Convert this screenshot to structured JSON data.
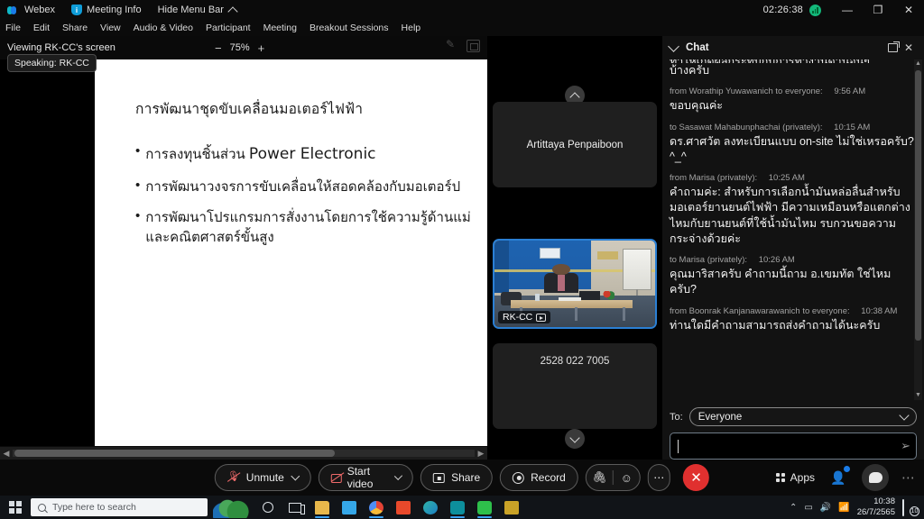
{
  "titlebar": {
    "app_name": "Webex",
    "meeting_info": "Meeting Info",
    "hide_menu_bar": "Hide Menu Bar",
    "timer": "02:26:38",
    "minimize": "—",
    "restore": "❐",
    "close": "✕"
  },
  "menubar": {
    "items": [
      "File",
      "Edit",
      "Share",
      "View",
      "Audio & Video",
      "Participant",
      "Meeting",
      "Breakout Sessions",
      "Help"
    ]
  },
  "sharebar": {
    "viewing_title": "Viewing RK-CC's screen",
    "zoom_out": "−",
    "zoom_level": "75%",
    "zoom_in": "+",
    "speaking_badge": "Speaking: RK-CC",
    "layout_button": "Layout"
  },
  "slide": {
    "title": "การพัฒนาชุดขับเคลื่อนมอเตอร์ไฟฟ้า",
    "bullets": [
      {
        "thai": "การลงทุนชิ้นส่วน ",
        "en": "Power Electronic"
      },
      {
        "thai": "การพัฒนาวงจรการขับเคลื่อนให้สอดคล้องกับมอเตอร์ป",
        "en": ""
      },
      {
        "thai": "การพัฒนาโปรแกรมการสั่งงานโดยการใช้ความรู้ด้านแม่ และคณิตศาสตร์ขั้นสูง",
        "en": ""
      }
    ]
  },
  "video_strip": {
    "scroll_up": "▲",
    "scroll_down": "▼",
    "tiles": [
      {
        "name": "Artittaya Penpaiboon",
        "type": "name-only"
      },
      {
        "name": "RK-CC",
        "type": "video",
        "active_speaker": true
      },
      {
        "name": "2528 022 7005",
        "type": "meeting-number"
      }
    ]
  },
  "chat": {
    "title": "Chat",
    "messages": [
      {
        "meta": "",
        "time": "",
        "text": "บ้างครับ",
        "truncated_top": true
      },
      {
        "meta": "from Worathip Yuwawanich to everyone:",
        "time": "9:56 AM",
        "text": "ขอบคุณค่ะ"
      },
      {
        "meta": "to Sasawat Mahabunphachai (privately):",
        "time": "10:15 AM",
        "text": "ดร.ศาศวัต ลงทะเบียนแบบ on-site ไม่ใช่เหรอครับ? ^_^"
      },
      {
        "meta": "from Marisa (privately):",
        "time": "10:25 AM",
        "text": "คำถามค่ะ: สำหรับการเลือกน้ำมันหล่อลื่นสำหรับมอเตอร์ยานยนต์ไฟฟ้า มีความเหมือนหรือแตกต่างไหมกับยานยนต์ที่ใช้น้ำมันไหม รบกวนขอความกระจ่างด้วยค่ะ"
      },
      {
        "meta": "to Marisa (privately):",
        "time": "10:26 AM",
        "text": "คุณมาริสาครับ คำถามนี้ถาม อ.เขมทัต ใช่ไหมครับ?"
      },
      {
        "meta": "from Boonrak Kanjanawarawanich to everyone:",
        "time": "10:38 AM",
        "text": "ท่านใดมีคำถามสามารถส่งคำถามได้นะครับ"
      }
    ],
    "to_label": "To:",
    "to_value": "Everyone",
    "message_placeholder": "",
    "message_value": ""
  },
  "controls": {
    "unmute": "Unmute",
    "start_video": "Start video",
    "share": "Share",
    "record": "Record",
    "apps": "Apps",
    "more": "⋯",
    "end_call": "✕",
    "reaction": "☺",
    "attach": "🔗"
  },
  "taskbar": {
    "search_placeholder": "Type here to search",
    "clock_time": "10:38",
    "clock_date": "26/7/2565",
    "notification_count": "10"
  },
  "colors": {
    "accent_blue": "#1a7ce8",
    "active_speaker": "#2a7fd4",
    "end_call_red": "#e0302f",
    "mute_red": "#ef6b6b",
    "network_green": "#13b87a"
  }
}
